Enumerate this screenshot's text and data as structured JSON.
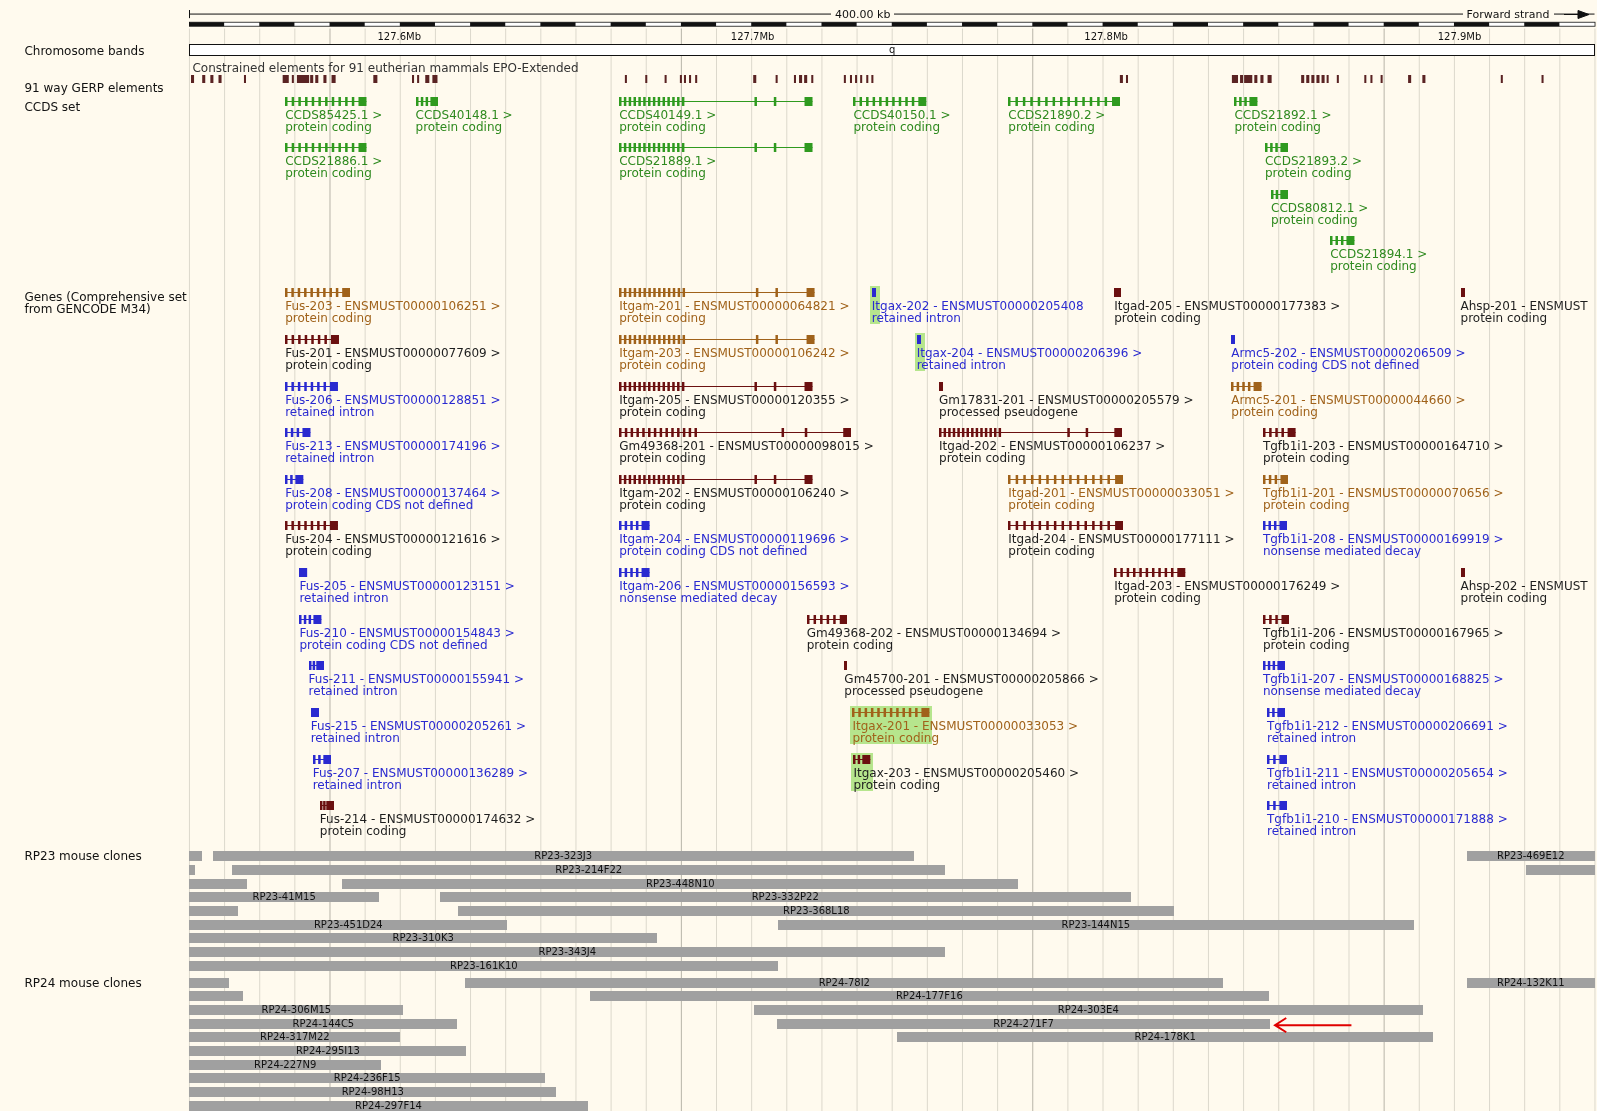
{
  "scale": {
    "size": "400.00 kb",
    "strand": "Forward strand",
    "ticks": [
      "127.6Mb",
      "127.7Mb",
      "127.8Mb",
      "127.9Mb"
    ]
  },
  "chromosome_bands": {
    "label": "Chromosome bands",
    "band": "q"
  },
  "gerp": {
    "label": "91 way GERP elements",
    "caption": "Constrained elements for 91 eutherian mammals EPO-Extended"
  },
  "ccds": {
    "label": "CCDS set",
    "items": [
      {
        "name": "CCDS85425.1 >",
        "biotype": "protein coding"
      },
      {
        "name": "CCDS40148.1 >",
        "biotype": "protein coding"
      },
      {
        "name": "CCDS40149.1 >",
        "biotype": "protein coding"
      },
      {
        "name": "CCDS40150.1 >",
        "biotype": "protein coding"
      },
      {
        "name": "CCDS21890.2 >",
        "biotype": "protein coding"
      },
      {
        "name": "CCDS21892.1 >",
        "biotype": "protein coding"
      },
      {
        "name": "CCDS21886.1 >",
        "biotype": "protein coding"
      },
      {
        "name": "CCDS21889.1 >",
        "biotype": "protein coding"
      },
      {
        "name": "CCDS21893.2 >",
        "biotype": "protein coding"
      },
      {
        "name": "CCDS80812.1 >",
        "biotype": "protein coding"
      },
      {
        "name": "CCDS21894.1 >",
        "biotype": "protein coding"
      }
    ]
  },
  "genes": {
    "label": "Genes (Comprehensive set from GENCODE M34)",
    "items": [
      {
        "name": "Fus-203 - ENSMUST00000106251 >",
        "biotype": "protein coding",
        "color": "#a0621a",
        "highlighted": false
      },
      {
        "name": "Itgam-201 - ENSMUST00000064821 >",
        "biotype": "protein coding",
        "color": "#a0621a",
        "highlighted": false
      },
      {
        "name": "Itgax-202 - ENSMUST00000205408",
        "biotype": "retained intron",
        "color": "#2a2ad0",
        "highlighted": true
      },
      {
        "name": "Itgad-205 - ENSMUST00000177383 >",
        "biotype": "protein coding",
        "color": "#6b1010",
        "highlighted": false
      },
      {
        "name": "Ahsp-201 - ENSMUST",
        "biotype": "protein coding",
        "color": "#6b1010",
        "highlighted": false
      },
      {
        "name": "Fus-201 - ENSMUST00000077609 >",
        "biotype": "protein coding",
        "color": "#6b1010",
        "highlighted": false
      },
      {
        "name": "Itgam-203 - ENSMUST00000106242 >",
        "biotype": "protein coding",
        "color": "#a0621a",
        "highlighted": false
      },
      {
        "name": "Itgax-204 - ENSMUST00000206396 >",
        "biotype": "retained intron",
        "color": "#2a2ad0",
        "highlighted": true
      },
      {
        "name": "Armc5-202 - ENSMUST00000206509 >",
        "biotype": "protein coding CDS not defined",
        "color": "#2a2ad0",
        "highlighted": false
      },
      {
        "name": "Fus-206 - ENSMUST00000128851 >",
        "biotype": "retained intron",
        "color": "#2a2ad0",
        "highlighted": false
      },
      {
        "name": "Itgam-205 - ENSMUST00000120355 >",
        "biotype": "protein coding",
        "color": "#6b1010",
        "highlighted": false
      },
      {
        "name": "Gm17831-201 - ENSMUST00000205579 >",
        "biotype": "processed pseudogene",
        "color": "#6b1010",
        "highlighted": false
      },
      {
        "name": "Armc5-201 - ENSMUST00000044660 >",
        "biotype": "protein coding",
        "color": "#a0621a",
        "highlighted": false
      },
      {
        "name": "Fus-213 - ENSMUST00000174196 >",
        "biotype": "retained intron",
        "color": "#2a2ad0",
        "highlighted": false
      },
      {
        "name": "Gm49368-201 - ENSMUST00000098015 >",
        "biotype": "protein coding",
        "color": "#6b1010",
        "highlighted": false
      },
      {
        "name": "Itgad-202 - ENSMUST00000106237 >",
        "biotype": "protein coding",
        "color": "#6b1010",
        "highlighted": false
      },
      {
        "name": "Tgfb1i1-203 - ENSMUST00000164710 >",
        "biotype": "protein coding",
        "color": "#6b1010",
        "highlighted": false
      },
      {
        "name": "Fus-208 - ENSMUST00000137464 >",
        "biotype": "protein coding CDS not defined",
        "color": "#2a2ad0",
        "highlighted": false
      },
      {
        "name": "Itgam-202 - ENSMUST00000106240 >",
        "biotype": "protein coding",
        "color": "#6b1010",
        "highlighted": false
      },
      {
        "name": "Itgad-201 - ENSMUST00000033051 >",
        "biotype": "protein coding",
        "color": "#a0621a",
        "highlighted": false
      },
      {
        "name": "Tgfb1i1-201 - ENSMUST00000070656 >",
        "biotype": "protein coding",
        "color": "#a0621a",
        "highlighted": false
      },
      {
        "name": "Fus-204 - ENSMUST00000121616 >",
        "biotype": "protein coding",
        "color": "#6b1010",
        "highlighted": false
      },
      {
        "name": "Itgam-204 - ENSMUST00000119696 >",
        "biotype": "protein coding CDS not defined",
        "color": "#2a2ad0",
        "highlighted": false
      },
      {
        "name": "Itgad-204 - ENSMUST00000177111 >",
        "biotype": "protein coding",
        "color": "#6b1010",
        "highlighted": false
      },
      {
        "name": "Tgfb1i1-208 - ENSMUST00000169919 >",
        "biotype": "nonsense mediated decay",
        "color": "#2a2ad0",
        "highlighted": false
      },
      {
        "name": "Fus-205 - ENSMUST00000123151 >",
        "biotype": "retained intron",
        "color": "#2a2ad0",
        "highlighted": false
      },
      {
        "name": "Itgam-206 - ENSMUST00000156593 >",
        "biotype": "nonsense mediated decay",
        "color": "#2a2ad0",
        "highlighted": false
      },
      {
        "name": "Itgad-203 - ENSMUST00000176249 >",
        "biotype": "protein coding",
        "color": "#6b1010",
        "highlighted": false
      },
      {
        "name": "Ahsp-202 - ENSMUST",
        "biotype": "protein coding",
        "color": "#6b1010",
        "highlighted": false
      },
      {
        "name": "Fus-210 - ENSMUST00000154843 >",
        "biotype": "protein coding CDS not defined",
        "color": "#2a2ad0",
        "highlighted": false
      },
      {
        "name": "Gm49368-202 - ENSMUST00000134694 >",
        "biotype": "protein coding",
        "color": "#6b1010",
        "highlighted": false
      },
      {
        "name": "Tgfb1i1-206 - ENSMUST00000167965 >",
        "biotype": "protein coding",
        "color": "#6b1010",
        "highlighted": false
      },
      {
        "name": "Fus-211 - ENSMUST00000155941 >",
        "biotype": "retained intron",
        "color": "#2a2ad0",
        "highlighted": false
      },
      {
        "name": "Gm45700-201 - ENSMUST00000205866 >",
        "biotype": "processed pseudogene",
        "color": "#6b1010",
        "highlighted": false
      },
      {
        "name": "Tgfb1i1-207 - ENSMUST00000168825 >",
        "biotype": "nonsense mediated decay",
        "color": "#2a2ad0",
        "highlighted": false
      },
      {
        "name": "Fus-215 - ENSMUST00000205261 >",
        "biotype": "retained intron",
        "color": "#2a2ad0",
        "highlighted": false
      },
      {
        "name": "Itgax-201 - ENSMUST00000033053 >",
        "biotype": "protein coding",
        "color": "#a0621a",
        "highlighted": true
      },
      {
        "name": "Tgfb1i1-212 - ENSMUST00000206691 >",
        "biotype": "retained intron",
        "color": "#2a2ad0",
        "highlighted": false
      },
      {
        "name": "Fus-207 - ENSMUST00000136289 >",
        "biotype": "retained intron",
        "color": "#2a2ad0",
        "highlighted": false
      },
      {
        "name": "Itgax-203 - ENSMUST00000205460 >",
        "biotype": "protein coding",
        "color": "#6b1010",
        "highlighted": true
      },
      {
        "name": "Tgfb1i1-211 - ENSMUST00000205654 >",
        "biotype": "retained intron",
        "color": "#2a2ad0",
        "highlighted": false
      },
      {
        "name": "Fus-214 - ENSMUST00000174632 >",
        "biotype": "protein coding",
        "color": "#6b1010",
        "highlighted": false
      },
      {
        "name": "Tgfb1i1-210 - ENSMUST00000171888 >",
        "biotype": "retained intron",
        "color": "#2a2ad0",
        "highlighted": false
      }
    ]
  },
  "rp23": {
    "label": "RP23 mouse clones",
    "clones": [
      {
        "name": "RP23-323J3"
      },
      {
        "name": "RP23-469E12"
      },
      {
        "name": "RP23-214F22"
      },
      {
        "name": "RP23-448N10"
      },
      {
        "name": "RP23-41M15"
      },
      {
        "name": "RP23-332P22"
      },
      {
        "name": "RP23-368L18"
      },
      {
        "name": "RP23-451D24"
      },
      {
        "name": "RP23-144N15"
      },
      {
        "name": "RP23-310K3"
      },
      {
        "name": "RP23-343J4"
      },
      {
        "name": "RP23-161K10"
      }
    ]
  },
  "rp24": {
    "label": "RP24 mouse clones",
    "clones": [
      {
        "name": "RP24-78I2"
      },
      {
        "name": "RP24-132K11"
      },
      {
        "name": "RP24-177F16"
      },
      {
        "name": "RP24-306M15"
      },
      {
        "name": "RP24-303E4"
      },
      {
        "name": "RP24-144C5"
      },
      {
        "name": "RP24-271F7"
      },
      {
        "name": "RP24-317M22"
      },
      {
        "name": "RP24-178K1"
      },
      {
        "name": "RP24-295I13"
      },
      {
        "name": "RP24-227N9"
      },
      {
        "name": "RP24-236F15"
      },
      {
        "name": "RP24-98H13"
      },
      {
        "name": "RP24-297F14"
      }
    ]
  }
}
